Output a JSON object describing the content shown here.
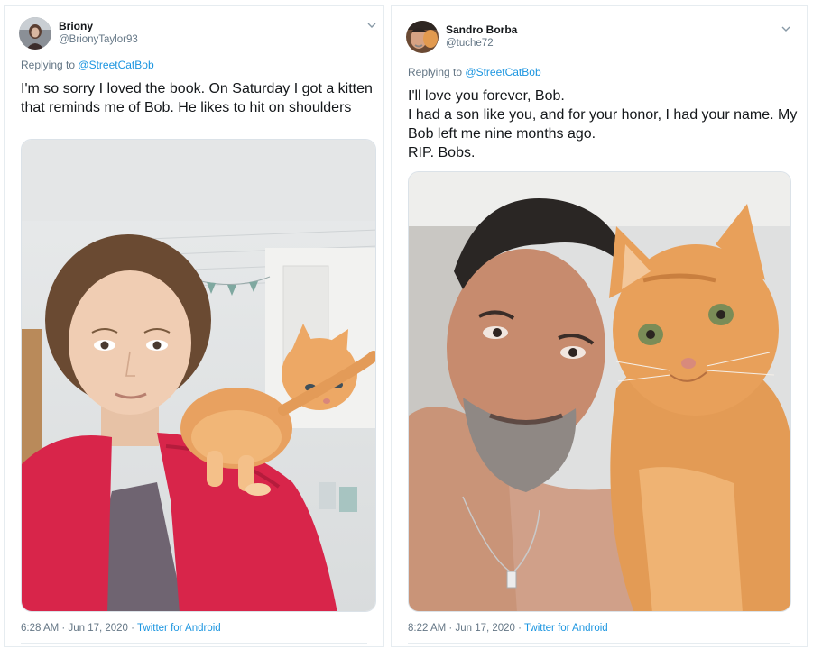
{
  "tweets": [
    {
      "display_name": "Briony",
      "handle": "@BrionyTaylor93",
      "replying_prefix": "Replying to",
      "replying_to": "@StreetCatBob",
      "text": "I'm so sorry I loved the book. On Saturday I got a kitten that reminds me of Bob. He likes to hit on shoulders",
      "time": "6:28 AM",
      "date": "Jun 17, 2020",
      "separator": "·",
      "source": "Twitter for Android"
    },
    {
      "display_name": "Sandro Borba",
      "handle": "@tuche72",
      "replying_prefix": "Replying to",
      "replying_to": "@StreetCatBob",
      "text": "I'll love you forever, Bob.\nI had a son like you, and for your honor, I had your name. My Bob left me nine months ago.\nRIP. Bobs.",
      "time": "8:22 AM",
      "date": "Jun 17, 2020",
      "separator": "·",
      "source": "Twitter for Android"
    }
  ],
  "icons": {
    "more": "chevron-down-icon"
  },
  "colors": {
    "link": "#1b95e0",
    "muted": "#657786",
    "text": "#14171a",
    "border": "#e6ecf0"
  }
}
